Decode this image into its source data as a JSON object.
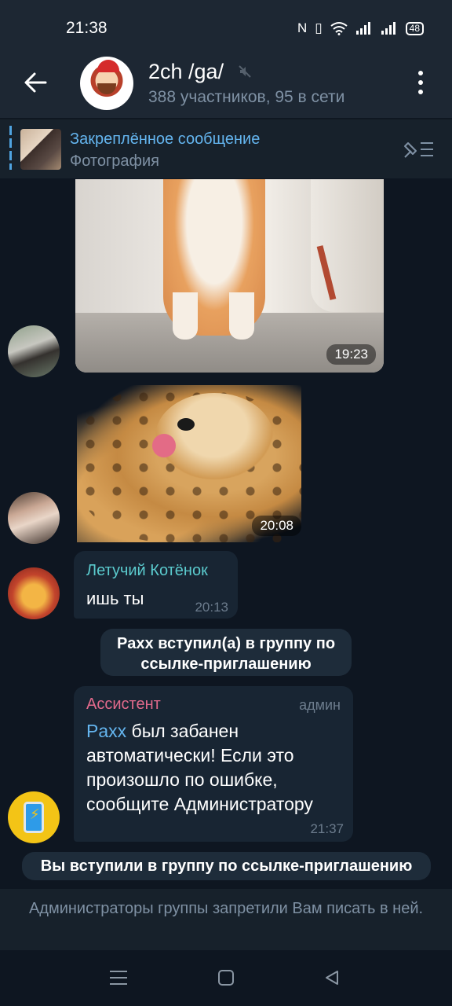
{
  "status": {
    "time": "21:38",
    "icons": [
      "nfc-icon",
      "vibrate-icon",
      "wifi-icon",
      "signal-icon",
      "signal-icon"
    ],
    "battery": "48"
  },
  "header": {
    "title": "2ch /ga/",
    "subtitle": "388 участников, 95 в сети"
  },
  "pinned": {
    "title": "Закреплённое сообщение",
    "subtitle": "Фотография"
  },
  "messages": {
    "photo_time": "19:23",
    "sticker_time": "20:08",
    "m1": {
      "sender": "Летучий Котёнок",
      "text": "ишь ты",
      "time": "20:13"
    },
    "service1": "Paxx вступил(а) в группу по ссылке-приглашению",
    "m2": {
      "sender": "Ассистент",
      "role": "админ",
      "mention": "Paxx",
      "text": " был забанен автоматически! Если это произошло по ошибке, сообщите Администратору",
      "time": "21:37"
    },
    "service2": "Вы вступили в группу по ссылке-приглашению"
  },
  "footer": {
    "notice": "Администраторы группы запретили Вам писать в ней."
  },
  "colors": {
    "background": "#0e1621",
    "bubble": "#182533",
    "link": "#64b5ef",
    "sender1": "#5bcbce",
    "sender2": "#e26a8c"
  }
}
